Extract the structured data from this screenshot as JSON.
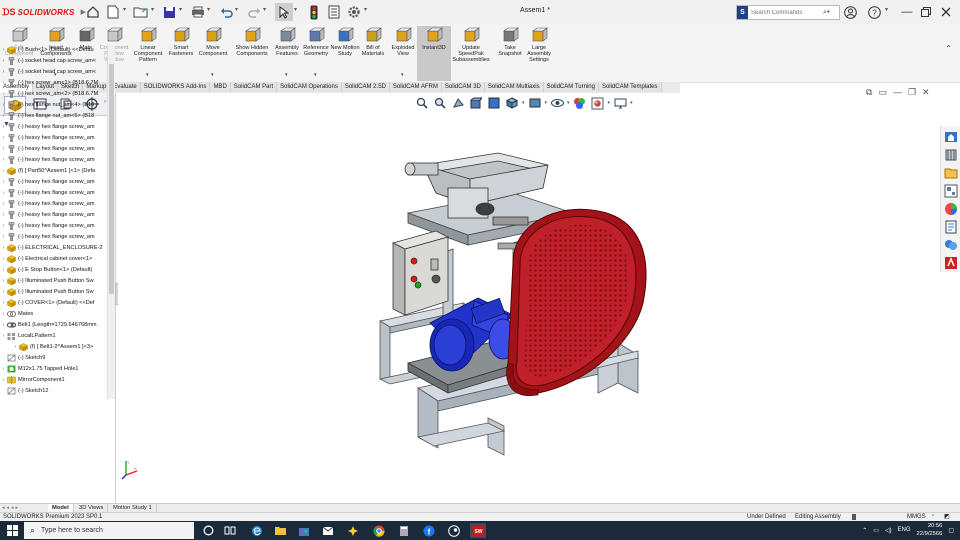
{
  "titlebar": {
    "app_brand": "SOLIDWORKS",
    "doc_title": "Assem1 *",
    "search_placeholder": "Search Commands"
  },
  "commands": [
    {
      "id": "edit-component",
      "label": "Edit Component",
      "disabled": true
    },
    {
      "id": "insert-components",
      "label": "Insert Components",
      "disabled": false
    },
    {
      "id": "mate",
      "label": "Mate",
      "disabled": false
    },
    {
      "id": "component-preview",
      "label": "Component Preview Window",
      "disabled": true
    },
    {
      "id": "linear-pattern",
      "label": "Linear Component Pattern",
      "disabled": false
    },
    {
      "id": "smart-fasteners",
      "label": "Smart Fasteners",
      "disabled": false
    },
    {
      "id": "move-component",
      "label": "Move Component",
      "disabled": false
    },
    {
      "id": "show-hidden",
      "label": "Show Hidden Components",
      "disabled": false
    },
    {
      "id": "assembly-features",
      "label": "Assembly Features",
      "disabled": false
    },
    {
      "id": "reference-geometry",
      "label": "Reference Geometry",
      "disabled": false
    },
    {
      "id": "new-motion-study",
      "label": "New Motion Study",
      "disabled": false
    },
    {
      "id": "bill-of-materials",
      "label": "Bill of Materials",
      "disabled": false
    },
    {
      "id": "exploded-view",
      "label": "Exploded View",
      "disabled": false
    },
    {
      "id": "instant3d",
      "label": "Instant3D",
      "disabled": false
    },
    {
      "id": "update-speedpak",
      "label": "Update SpeedPak Subassemblies",
      "disabled": false
    },
    {
      "id": "take-snapshot",
      "label": "Take Snapshot",
      "disabled": false
    },
    {
      "id": "large-assembly",
      "label": "Large Assembly Settings",
      "disabled": false
    }
  ],
  "tabs": [
    "Assembly",
    "Layout",
    "Sketch",
    "Markup",
    "Evaluate",
    "SOLIDWORKS Add-Ins",
    "MBD",
    "SolidCAM Part",
    "SolidCAM Operations",
    "SolidCAM 2.5D",
    "SolidCAM AFRM",
    "SolidCAM 3D",
    "SolidCAM Multiaxis",
    "SolidCAM Turning",
    "SolidCAM Templates"
  ],
  "tree": [
    {
      "label": "(-) Bush<1> (Default) <<Defau",
      "icon": "part"
    },
    {
      "label": "(-) socket head cap screw_am<",
      "icon": "screw"
    },
    {
      "label": "(-) socket head cap screw_am<",
      "icon": "screw"
    },
    {
      "label": "(-) hex screw_am<1> (B18.6.7M",
      "icon": "screw"
    },
    {
      "label": "(-) hex screw_am<2> (B18.6.7M",
      "icon": "screw"
    },
    {
      "label": "(-) hex flange nut_am<4> (B18",
      "icon": "screw"
    },
    {
      "label": "(-) hex flange nut_am<5> (B18",
      "icon": "screw"
    },
    {
      "label": "(-) heavy hex flange screw_am",
      "icon": "screw"
    },
    {
      "label": "(-) heavy hex flange screw_am",
      "icon": "screw"
    },
    {
      "label": "(-) heavy hex flange screw_am",
      "icon": "screw"
    },
    {
      "label": "(-) heavy hex flange screw_am",
      "icon": "screw"
    },
    {
      "label": "(f) [ Part50^Assem1 ]<1> (Defa",
      "icon": "part"
    },
    {
      "label": "(-) heavy hex flange screw_am",
      "icon": "screw"
    },
    {
      "label": "(-) heavy hex flange screw_am",
      "icon": "screw"
    },
    {
      "label": "(-) heavy hex flange screw_am",
      "icon": "screw"
    },
    {
      "label": "(-) heavy hex flange screw_am",
      "icon": "screw"
    },
    {
      "label": "(-) heavy hex flange screw_am",
      "icon": "screw"
    },
    {
      "label": "(-) heavy hex flange screw_am",
      "icon": "screw"
    },
    {
      "label": "(-) ELECTRICAL_ENCLOSURE-2",
      "icon": "part"
    },
    {
      "label": "(-) Electrical cabinet cover<1>",
      "icon": "part"
    },
    {
      "label": "(-) E Stop Button<1> (Default)",
      "icon": "part"
    },
    {
      "label": "(-) Illuminated Push Button Sw",
      "icon": "part"
    },
    {
      "label": "(-) Illuminated Push Button Sw",
      "icon": "part"
    },
    {
      "label": "(-) COVER<1> (Default) <<Def",
      "icon": "part"
    },
    {
      "label": "Mates",
      "icon": "mates"
    },
    {
      "label": "Belt1 (Length=1729.646768mm",
      "icon": "belt"
    },
    {
      "label": "LocalLPattern1",
      "icon": "pattern"
    },
    {
      "label": "(f) [ Belt1-2^Assem1 ]<3>",
      "icon": "part",
      "indent": 1
    },
    {
      "label": "(-) Sketch9",
      "icon": "sketch"
    },
    {
      "label": "M12x1.75 Tapped Hole1",
      "icon": "hole"
    },
    {
      "label": "MirrorComponent1",
      "icon": "mirror"
    },
    {
      "label": "(-) Sketch12",
      "icon": "sketch"
    }
  ],
  "bottom_tabs": [
    "Model",
    "3D Views",
    "Motion Study 1"
  ],
  "status": {
    "edition": "SOLIDWORKS Premium 2023 SP0.1",
    "state": "Under Defined",
    "mode": "Editing Assembly",
    "units": "MMGS"
  },
  "taskbar": {
    "search_placeholder": "Type here to search",
    "lang": "ENG",
    "time": "20:56",
    "date": "22/9/2566"
  },
  "colors": {
    "brand_red": "#d11111",
    "taskbar": "#1b2a3a",
    "active_button": "#c9c9c9"
  }
}
